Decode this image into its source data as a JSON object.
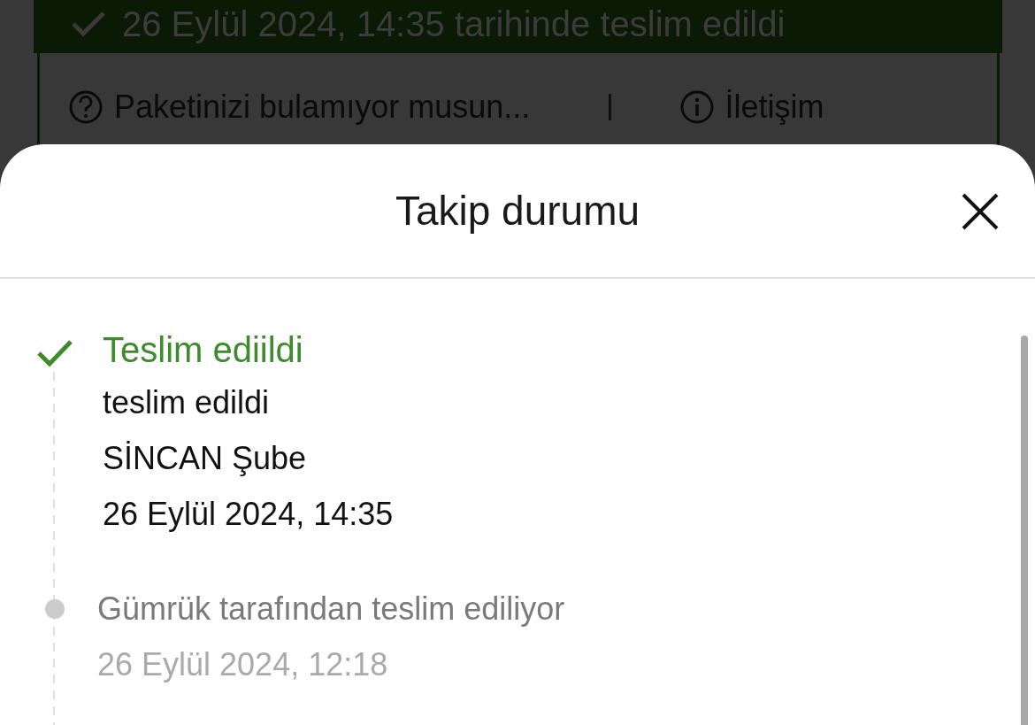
{
  "background": {
    "banner": "26 Eylül 2024, 14:35 tarihinde teslim edildi",
    "help_link": "Paketinizi bulamıyor musun...",
    "separator": "|",
    "contact_link": "İletişim"
  },
  "sheet": {
    "title": "Takip durumu",
    "events": [
      {
        "kind": "completed",
        "title": "Teslim ediildi",
        "lines": [
          "teslim edildi",
          "SİNCAN Şube",
          "26 Eylül 2024, 14:35"
        ]
      },
      {
        "kind": "pending",
        "title": "Gümrük tarafından teslim ediliyor",
        "lines": [
          "26 Eylül 2024, 12:18"
        ]
      }
    ]
  }
}
